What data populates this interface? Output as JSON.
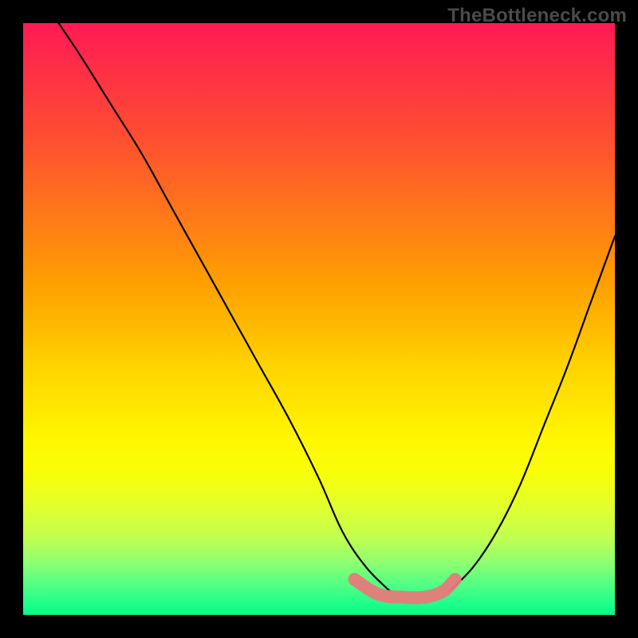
{
  "watermark": {
    "text": "TheBottleneck.com"
  },
  "colors": {
    "frame_bg": "#000000",
    "watermark": "#4a4a4a",
    "curve": "#000000",
    "highlight": "#e77a7a"
  },
  "chart_data": {
    "type": "line",
    "title": "",
    "xlabel": "",
    "ylabel": "",
    "xlim": [
      0,
      100
    ],
    "ylim": [
      0,
      100
    ],
    "grid": false,
    "legend": false,
    "series": [
      {
        "name": "left-curve",
        "x": [
          6,
          10,
          15,
          20,
          25,
          30,
          35,
          40,
          45,
          50,
          54,
          58,
          62
        ],
        "y": [
          100,
          94,
          86,
          78,
          69,
          60,
          51,
          42,
          33,
          23,
          14,
          8,
          4
        ]
      },
      {
        "name": "right-curve",
        "x": [
          72,
          76,
          80,
          84,
          88,
          92,
          96,
          100
        ],
        "y": [
          4,
          8,
          14,
          22,
          32,
          42,
          53,
          64
        ]
      },
      {
        "name": "trough-highlight",
        "x": [
          56,
          60,
          64,
          68,
          71,
          73
        ],
        "y": [
          6,
          3.5,
          3,
          3,
          4,
          6
        ]
      }
    ],
    "annotations": []
  }
}
